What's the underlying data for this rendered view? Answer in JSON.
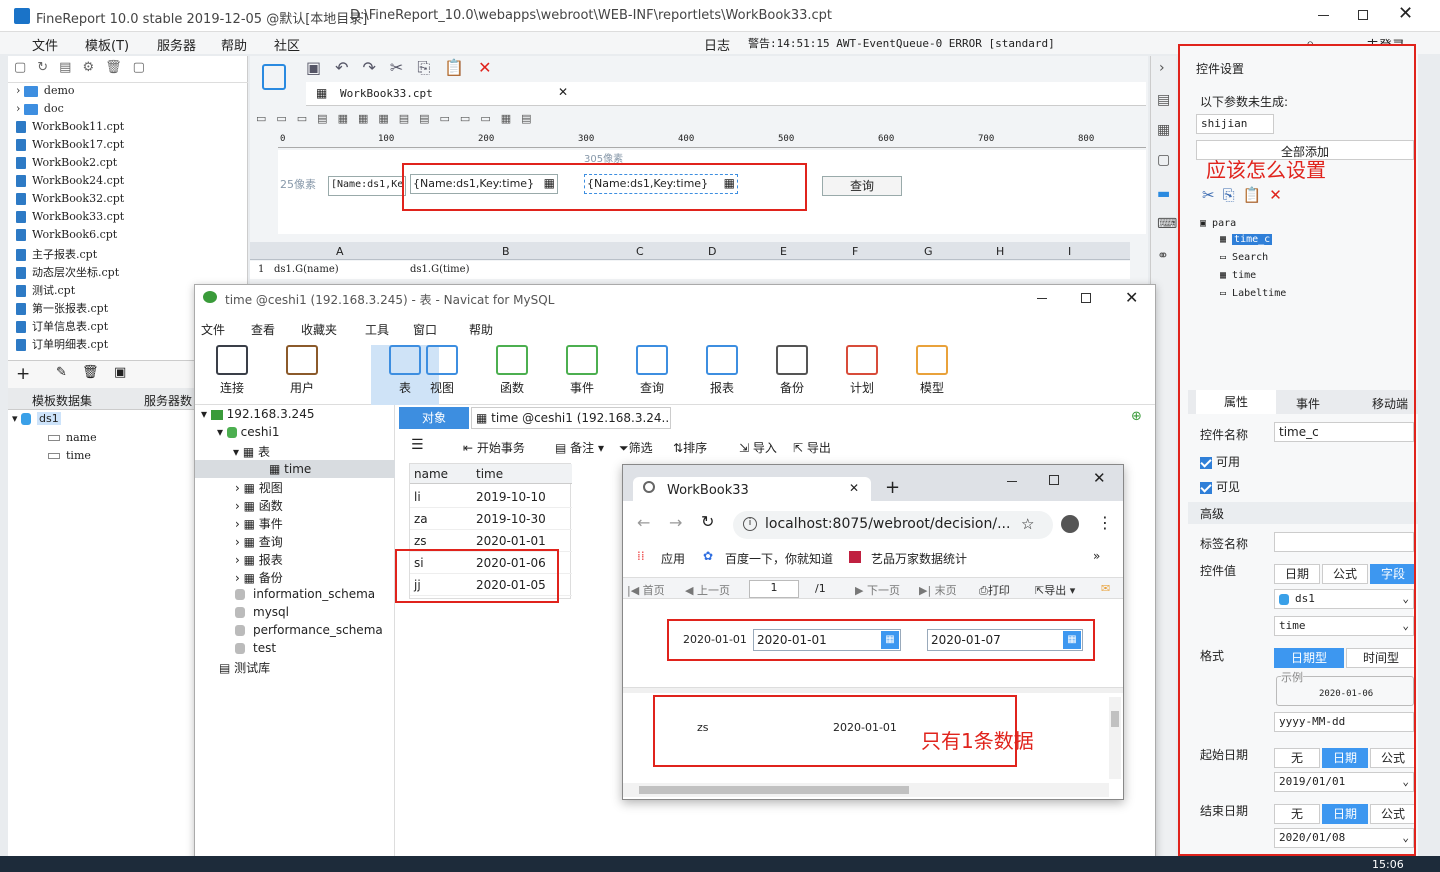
{
  "fr": {
    "title": "FineReport 10.0 stable 2019-12-05 @默认[本地目录]",
    "path": "D:\\FineReport_10.0\\webapps\\webroot\\WEB-INF\\reportlets\\WorkBook33.cpt",
    "menu": [
      "文件",
      "模板(T)",
      "服务器",
      "帮助",
      "社区"
    ],
    "log": "日志",
    "warn": "警告:14:51:15 AWT-EventQueue-0 ERROR [standard]",
    "login": "未登录"
  },
  "tree": {
    "items": [
      "demo",
      "doc",
      "WorkBook11.cpt",
      "WorkBook17.cpt",
      "WorkBook2.cpt",
      "WorkBook24.cpt",
      "WorkBook32.cpt",
      "WorkBook33.cpt",
      "WorkBook6.cpt",
      "主子报表.cpt",
      "动态层次坐标.cpt",
      "测试.cpt",
      "第一张报表.cpt",
      "订单信息表.cpt",
      "订单明细表.cpt"
    ],
    "tabs": [
      "模板数据集",
      "服务器数"
    ],
    "ds": "ds1",
    "fields": [
      "name",
      "time"
    ]
  },
  "editor": {
    "tab": "WorkBook33.cpt",
    "ruler": [
      "0",
      "100",
      "200",
      "300",
      "400",
      "500",
      "600",
      "700",
      "800"
    ],
    "px_hint": "305像素",
    "px_label": "25像素",
    "param1": "[Name:ds1,Ke",
    "param2": "{Name:ds1,Key:time}",
    "param3": "{Name:ds1,Key:time}",
    "query_btn": "查询",
    "cols": [
      "A",
      "B",
      "C",
      "D",
      "E",
      "F",
      "G",
      "H",
      "I"
    ],
    "row_num": "1",
    "cellA": "ds1.G(name)",
    "cellB": "ds1.G(time)"
  },
  "navicat": {
    "title": "time @ceshi1 (192.168.3.245) - 表 - Navicat for MySQL",
    "menu": [
      "文件",
      "查看",
      "收藏夹",
      "工具",
      "窗口",
      "帮助"
    ],
    "tools": [
      "连接",
      "用户",
      "表",
      "视图",
      "函数",
      "事件",
      "查询",
      "报表",
      "备份",
      "计划",
      "模型"
    ],
    "nav": {
      "conn": "192.168.3.245",
      "db": "ceshi1",
      "table_group": "表",
      "table": "time",
      "groups": [
        "视图",
        "函数",
        "事件",
        "查询",
        "报表",
        "备份"
      ],
      "others": [
        "information_schema",
        "mysql",
        "performance_schema",
        "test"
      ],
      "lib": "测试库"
    },
    "tab_obj": "对象",
    "tab_table": "time @ceshi1 (192.168.3.24...",
    "actions": [
      "开始事务",
      "备注",
      "筛选",
      "排序",
      "导入",
      "导出"
    ],
    "columns": [
      "name",
      "time"
    ],
    "rows": [
      [
        "li",
        "2019-10-10"
      ],
      [
        "za",
        "2019-10-30"
      ],
      [
        "zs",
        "2020-01-01"
      ],
      [
        "si",
        "2020-01-06"
      ],
      [
        "jj",
        "2020-01-05"
      ]
    ]
  },
  "browser": {
    "tab": "WorkBook33",
    "url": "localhost:8075/webroot/decision/...",
    "bm_apps": "应用",
    "bm1": "百度一下，你就知道",
    "bm2": "艺品万家数据统计",
    "nav": [
      "首页",
      "上一页",
      "下一页",
      "末页",
      "打印",
      "导出"
    ],
    "page": "1",
    "page_total": "/1",
    "p_label": "2020-01-01",
    "p_start": "2020-01-01",
    "p_end": "2020-01-07",
    "r_name": "zs",
    "r_time": "2020-01-01",
    "note": "只有1条数据"
  },
  "panel": {
    "title": "控件设置",
    "ungen": "以下参数未生成:",
    "param": "shijian",
    "add_all": "全部添加",
    "question": "应该怎么设置",
    "tree": [
      "para",
      "time_c",
      "Search",
      "time",
      "Labeltime"
    ],
    "tabs": [
      "属性",
      "事件",
      "移动端"
    ],
    "name_label": "控件名称",
    "name_val": "time_c",
    "enabled": "可用",
    "visible": "可见",
    "advanced": "高级",
    "label_name": "标签名称",
    "value_label": "控件值",
    "value_types": [
      "日期",
      "公式",
      "字段"
    ],
    "ds": "ds1",
    "field": "time",
    "format_label": "格式",
    "format_types": [
      "日期型",
      "时间型"
    ],
    "example": "示例",
    "example_val": "2020-01-06",
    "format_val": "yyyy-MM-dd",
    "start_label": "起始日期",
    "end_label": "结束日期",
    "opts": [
      "无",
      "日期",
      "公式"
    ],
    "start_val": "2019/01/01",
    "end_val": "2020/01/08"
  },
  "taskbar": {
    "time": "15:06"
  }
}
